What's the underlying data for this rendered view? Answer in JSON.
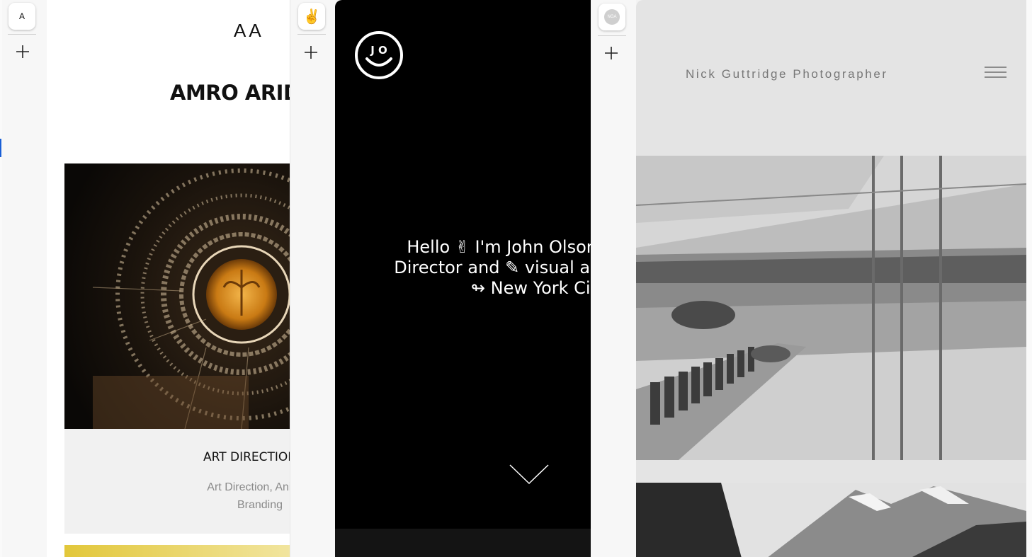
{
  "panels": [
    {
      "favicon_label": "A",
      "site": {
        "logo": "AA",
        "title": "AMRO ARID",
        "card_title": "ART DIRECTION RE",
        "card_subtitle_line1": "Art Direction, Animati",
        "card_subtitle_line2": "Branding"
      }
    },
    {
      "favicon_label": "✌",
      "site": {
        "logo_letters": "J O",
        "hero_line1": "Hello ✌ I'm John Olson",
        "hero_line2": "Director and ✎ visual ar",
        "hero_line3": "↬ New York Cit"
      }
    },
    {
      "favicon_label": "NGA",
      "site": {
        "title": "Nick Guttridge Photographer"
      }
    }
  ],
  "icons": {
    "add": "plus-icon",
    "menu": "hamburger-menu-icon",
    "scroll": "chevron-down-icon"
  },
  "colors": {
    "panel2_bg": "#000000",
    "panel3_bg": "#e4e4e4",
    "accent_yellow": "#e2c73a"
  }
}
